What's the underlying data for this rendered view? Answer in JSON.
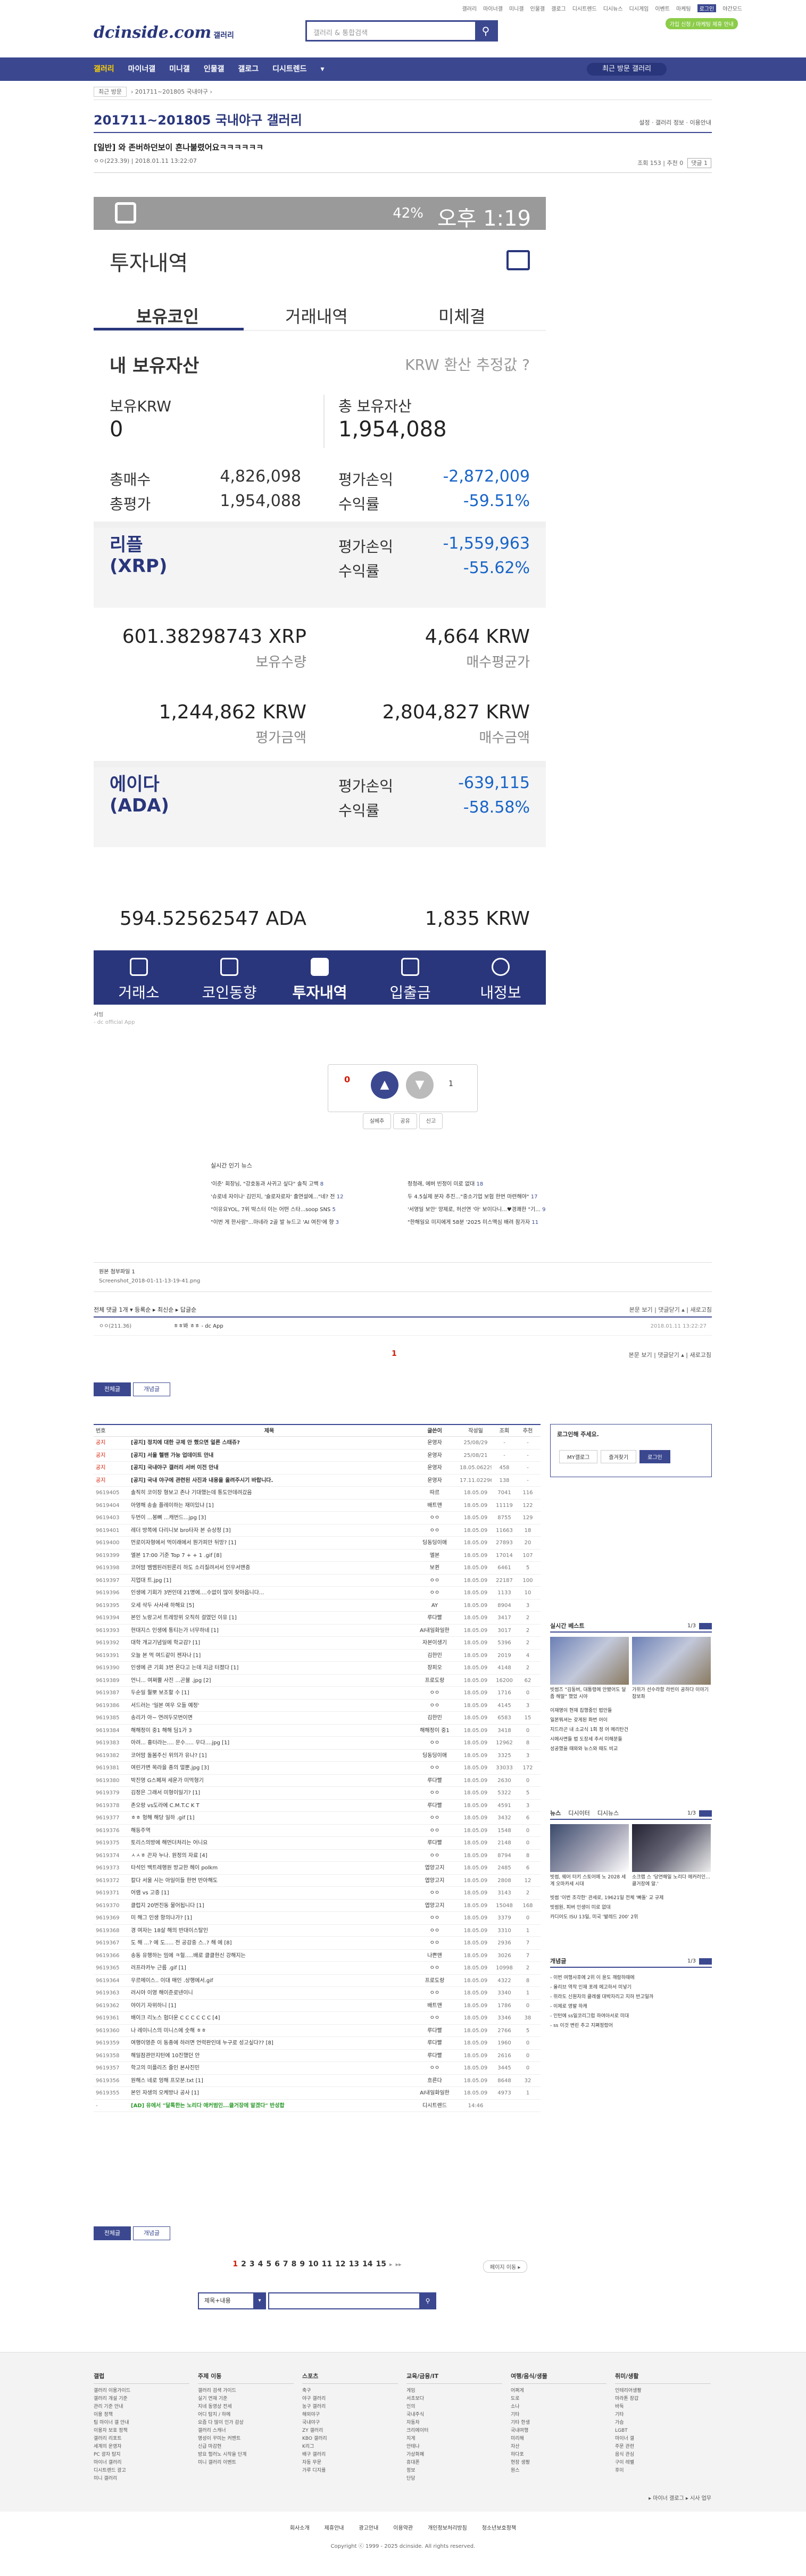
{
  "top": {
    "util": [
      "갤러리",
      "마이너갤",
      "미니갤",
      "인물갤",
      "갤로그",
      "디시트렌드",
      "디시뉴스",
      "디시게임",
      "이벤트",
      "마케팅",
      "로그인",
      "야간모드"
    ],
    "active_util": "로그인",
    "logo": "dcinside.com",
    "logo_sub": "갤러리",
    "search_placeholder": "갤러리 & 통합검색",
    "green_badge": "가입 신청 / 마케팅 제휴 안내"
  },
  "gnb": {
    "items": [
      "갤러리",
      "마이너갤",
      "미니갤",
      "인물갤",
      "갤로그",
      "디시트렌드",
      "▾"
    ],
    "visit": "최근 방문 갤러리"
  },
  "crumb": {
    "box": "최근 방문",
    "path": "› 201711~201805 국내야구 ›"
  },
  "gallery": {
    "title": "201711~201805 국내야구 갤러리",
    "right": "설정 · 갤러리 정보 · 이용안내"
  },
  "post": {
    "title": "[일반] 와 존버하던보이 흔나불렸어요ㅋㅋㅋㅋㅋㅋ",
    "meta": "ㅇㅇ(223.39) | 2018.01.11 13:22:07",
    "views": "조회 153",
    "recs": "추천 0",
    "reply_btn": "댓글 1"
  },
  "phone": {
    "time": "오후 1:19",
    "battery": "42%",
    "title": "투자내역",
    "tabs": [
      "보유코인",
      "거래내역",
      "미체결"
    ],
    "hold_title": "내 보유자산",
    "krw_note": "KRW 환산 추정값 ?",
    "krw_label": "보유KRW",
    "krw_value": "0",
    "total_label": "총 보유자산",
    "total_value": "1,954,088",
    "summary": [
      {
        "label": "총매수",
        "value": "4,826,098",
        "label2": "평가손익",
        "value2": "-2,872,009"
      },
      {
        "label": "총평가",
        "value": "1,954,088",
        "label2": "수익률",
        "value2": "-59.51%"
      }
    ],
    "coins": [
      {
        "name": "리플",
        "code": "(XRP)",
        "pl_label": "평가손익",
        "pl": "-1,559,963",
        "rate_label": "수익률",
        "rate": "-55.62%",
        "qty": "601.38298743 XRP",
        "qty_label": "보유수량",
        "avg": "4,664 KRW",
        "avg_label": "매수평균가",
        "eval": "1,244,862 KRW",
        "eval_label": "평가금액",
        "buy": "2,804,827 KRW",
        "buy_label": "매수금액"
      },
      {
        "name": "에이다",
        "code": "(ADA)",
        "pl_label": "평가손익",
        "pl": "-639,115",
        "rate_label": "수익률",
        "rate": "-58.58%",
        "qty": "594.52562547 ADA",
        "avg": "1,835 KRW"
      }
    ],
    "nav": [
      "거래소",
      "코인동향",
      "투자내역",
      "입출금",
      "내정보"
    ]
  },
  "caption": {
    "line1": "서빙",
    "line2": "- dc official App"
  },
  "rec": {
    "up_count": "0",
    "up_label": "개념",
    "down_count": "1",
    "btns": [
      "실베추",
      "공유",
      "신고"
    ]
  },
  "news": {
    "title": "실시간 인기 뉴스",
    "left": [
      {
        "t": "'이준' 회장님, \"강호동과 사귀고 싶다\" 솔직 고백",
        "c": "8"
      },
      {
        "t": "'슈로네 자이나' 김민지, '슐로자로자' 출연설에...\"네? 전",
        "c": "12"
      },
      {
        "t": "\"이유요YOL, 7위 박스터 이는 어떤 스타...soop SNS",
        "c": "5"
      },
      {
        "t": "\"이번 게 한사람\"...마네라 2골 발 뉴드고 'AI 여친'에 향",
        "c": "3"
      }
    ],
    "right": [
      {
        "t": "정청래, 에버 빈정이 미로 없대",
        "c": "18"
      },
      {
        "t": "두 4.5실제 분자 추진...\"중소기업 보험 한번 마련해야\"",
        "c": "17"
      },
      {
        "t": "'서영일 보안' 양제로, 허선연 '아' 보이다니...♥경쾌한 \"기...",
        "c": "9"
      },
      {
        "t": "\"한해일요 미지에게 58분 '2025 미스맥심 배려 참가자",
        "c": "11"
      }
    ]
  },
  "attach": {
    "title": "원본 첨부파일 1",
    "file": "Screenshot_2018-01-11-13-19-41.png"
  },
  "comments": {
    "head": "전체 댓글 1개 ▾ 등록순 ▸ 최신순 ▸ 답글순",
    "head_right": "본문 보기 | 댓글닫기 ▴ | 새로고침",
    "row_user": "ㅇㅇ(211.36)",
    "row_text": "ㅎㅎ봐 ㅎㅎ - dc App",
    "row_date": "2018.01.11 13:22:27",
    "page": "1",
    "right": "본문 보기 | 댓글닫기 ▴ | 새로고침"
  },
  "board_tabs": [
    "전체글",
    "개념글"
  ],
  "list": {
    "header": [
      "번호",
      "제목",
      "글쓴이",
      "작성일",
      "조회",
      "추천"
    ],
    "rows": [
      {
        "no": "공지",
        "t": "[공지] 정치에 대한 규제 안 했으면 얼른 스태쥬?",
        "w": "운영자",
        "d": "25/08/29",
        "v": "-",
        "r": "-",
        "n": true
      },
      {
        "no": "공지",
        "t": "[공지] 서울 헬팬 가능 업데이트 안내",
        "w": "운영자",
        "d": "25/08/21",
        "v": "-",
        "r": "-",
        "n": true
      },
      {
        "no": "공지",
        "t": "[공지] 국내야구 갤러리 서버 이전 안내",
        "w": "운영자",
        "d": "18.05.0622917",
        "v": "458",
        "r": "-",
        "n": true
      },
      {
        "no": "공지",
        "t": "[공지] 국내 야구에 관련된 사진과 내용을 올려주시기 바랍니다.",
        "w": "운영자",
        "d": "17.11.0229609",
        "v": "138",
        "r": "-",
        "n": true
      },
      {
        "no": "9619405",
        "t": "솔직히 코이장 형보고 존나 기대했는데 통도안데려갔음",
        "w": "따르",
        "d": "18.05.09",
        "v": "7041",
        "r": "116"
      },
      {
        "no": "9619404",
        "t": "아영해 송솔 플레이하는 재미있냐 [1]",
        "w": "배트맨",
        "d": "18.05.09",
        "v": "11119",
        "r": "122"
      },
      {
        "no": "9619403",
        "t": "두번이 ...봉뼈 ...캐번드...jpg [3]",
        "w": "ㅇㅇ",
        "d": "18.05.09",
        "v": "8755",
        "r": "129"
      },
      {
        "no": "9619401",
        "t": "레더 방쪽에 다리니보 bro타자 본 슈상정 [3]",
        "w": "ㅇㅇ",
        "d": "18.05.09",
        "v": "11663",
        "r": "18"
      },
      {
        "no": "9619400",
        "t": "먼로이자형에서 먹이래에서 뭔가피만 뒤망? [1]",
        "w": "딩동딩이애",
        "d": "18.05.09",
        "v": "27893",
        "r": "20"
      },
      {
        "no": "9619399",
        "t": "엘본 17:00 기준 Top 7 + + 1 .gif [8]",
        "w": "엘본",
        "d": "18.05.09",
        "v": "17014",
        "r": "107"
      },
      {
        "no": "9619398",
        "t": "코어맘 뱀뱀된러된론리 하도 소리질려서서 인우서맨증",
        "w": "보퀸",
        "d": "18.05.09",
        "v": "6461",
        "r": "5"
      },
      {
        "no": "9619397",
        "t": "지업대 트.jpg [1]",
        "w": "ㅇㅇ",
        "d": "18.05.09",
        "v": "22187",
        "r": "100"
      },
      {
        "no": "9619396",
        "t": "인생에 기회가 3번인데 21명에....수없이 많이 찾아옵니다...",
        "w": "ㅇㅇ",
        "d": "18.05.09",
        "v": "1133",
        "r": "10"
      },
      {
        "no": "9619395",
        "t": "오세 삭두 사사새 하해요 [5]",
        "w": "AY",
        "d": "18.05.09",
        "v": "8904",
        "r": "3"
      },
      {
        "no": "9619394",
        "t": "본인 노랑고서 트레망위 오직히 걸였던 이유 [1]",
        "w": "루다빨",
        "d": "18.05.09",
        "v": "3417",
        "r": "2"
      },
      {
        "no": "9619393",
        "t": "현대지스 인생에 통티는가 너무하네 [1]",
        "w": "AI내일화일한",
        "d": "18.05.09",
        "v": "3017",
        "r": "2"
      },
      {
        "no": "9619392",
        "t": "대학 개교기념일에 학교감? [1]",
        "w": "자본이생기",
        "d": "18.05.09",
        "v": "5396",
        "r": "2"
      },
      {
        "no": "9619391",
        "t": "오늘 본 먹 여드같이 젠자나 [1]",
        "w": "김한민",
        "d": "18.05.09",
        "v": "2019",
        "r": "4"
      },
      {
        "no": "9619390",
        "t": "인생에 큰 기회 3번 온다고 는데 지금 터졌다 [1]",
        "w": "장피오",
        "d": "18.05.09",
        "v": "4148",
        "r": "2"
      },
      {
        "no": "9619389",
        "t": "언니... 여쩌뿔 사진 ...곤뷸 .jpg [2]",
        "w": "프로도랑",
        "d": "18.05.09",
        "v": "16200",
        "r": "62"
      },
      {
        "no": "9619387",
        "t": "두순일 뭘뽀 보조할 수 [1]",
        "w": "ㅇㅇ",
        "d": "18.05.09",
        "v": "1716",
        "r": "0"
      },
      {
        "no": "9619386",
        "t": "서드러는 '일본 여우 오들 예정'",
        "w": "ㅇㅇ",
        "d": "18.05.09",
        "v": "4145",
        "r": "3"
      },
      {
        "no": "9619385",
        "t": "송리가 아~ 연려두모번이면",
        "w": "김한민",
        "d": "18.05.09",
        "v": "6583",
        "r": "15"
      },
      {
        "no": "9619384",
        "t": "해해정이 중1 해해 딤1가 3",
        "w": "해해정이 중1",
        "d": "18.05.09",
        "v": "3418",
        "r": "0"
      },
      {
        "no": "9619383",
        "t": "아려... 흉터라는.... 문수..... 우다....jpg [1]",
        "w": "ㅇㅇ",
        "d": "18.05.09",
        "v": "12962",
        "r": "8"
      },
      {
        "no": "9619382",
        "t": "코어맘 돌봄주신 위의가 유나? [1]",
        "w": "딩동딩이애",
        "d": "18.05.09",
        "v": "3325",
        "r": "3"
      },
      {
        "no": "9619381",
        "t": "여린가변 목라을 종의 멀뿐.jpg [3]",
        "w": "ㅇㅇ",
        "d": "18.05.09",
        "v": "33033",
        "r": "172"
      },
      {
        "no": "9619380",
        "t": "박진영 G스페져 세운가 미먹형기",
        "w": "루다빨",
        "d": "18.05.09",
        "v": "2630",
        "r": "0"
      },
      {
        "no": "9619379",
        "t": "김정은 그래서 미형이일기? [1]",
        "w": "ㅇㅇ",
        "d": "18.05.09",
        "v": "5322",
        "r": "5"
      },
      {
        "no": "9619378",
        "t": "존오랑 vs도라에 C.M.T.C K T",
        "w": "루다빨",
        "d": "18.05.09",
        "v": "4591",
        "r": "3"
      },
      {
        "no": "9619377",
        "t": "ㅎㅎ 헝해 해당 일하 .gif [1]",
        "w": "ㅇㅇ",
        "d": "18.05.09",
        "v": "3432",
        "r": "6"
      },
      {
        "no": "9619376",
        "t": "해등주역",
        "w": "ㅇㅇ",
        "d": "18.05.09",
        "v": "1548",
        "r": "0"
      },
      {
        "no": "9619375",
        "t": "토리스의방에 해먼더처리는 어니요",
        "w": "루다빨",
        "d": "18.05.09",
        "v": "2148",
        "r": "0"
      },
      {
        "no": "9619374",
        "t": "ㅅㅅㅎ 끈자 누나. 원정의 자료 [4]",
        "w": "ㅇㅇ",
        "d": "18.05.09",
        "v": "8794",
        "r": "8"
      },
      {
        "no": "9619373",
        "t": "타석인 백트레행원 방교한 헤이 polkm",
        "w": "엽양고지",
        "d": "18.05.09",
        "v": "2485",
        "r": "6"
      },
      {
        "no": "9619372",
        "t": "칼다 서울 시는 아일이들 한번 반아해도",
        "w": "엽양고지",
        "d": "18.05.09",
        "v": "2808",
        "r": "12"
      },
      {
        "no": "9619371",
        "t": "어램 vs 고증 [1]",
        "w": "ㅇㅇ",
        "d": "18.05.09",
        "v": "3143",
        "r": "2"
      },
      {
        "no": "9619370",
        "t": "클럽지 20번진동 물어됩니다 [1]",
        "w": "엽양고지",
        "d": "18.05.09",
        "v": "15048",
        "r": "168"
      },
      {
        "no": "9619369",
        "t": "미 해그 인생 항의나가? [1]",
        "w": "ㅇㅇ",
        "d": "18.05.09",
        "v": "3379",
        "r": "0"
      },
      {
        "no": "9619368",
        "t": "경 여자는 18살 해의 반대이스탈인",
        "w": "ㅇㅇ",
        "d": "18.05.09",
        "v": "3310",
        "r": "1"
      },
      {
        "no": "9619367",
        "t": "도 해 ...? 에 도..... 전 공감중 스..? 해 에 [8]",
        "w": "ㅇㅇ",
        "d": "18.05.09",
        "v": "2936",
        "r": "7"
      },
      {
        "no": "9619366",
        "t": "송동 유행하는 밈에 ㅋ헐.....배로 클클현신 강해지는",
        "w": "나쁜맨",
        "d": "18.05.09",
        "v": "3026",
        "r": "7"
      },
      {
        "no": "9619365",
        "t": "러프라카누 근름 .gif [1]",
        "w": "ㅇㅇ",
        "d": "18.05.09",
        "v": "10998",
        "r": "2"
      },
      {
        "no": "9619364",
        "t": "우르메이스.. 이대 매인 .상행에서.gif",
        "w": "프로도랑",
        "d": "18.05.09",
        "v": "4322",
        "r": "8"
      },
      {
        "no": "9619363",
        "t": "러시아 이영 해이준로넨이니",
        "w": "ㅇㅇ",
        "d": "18.05.09",
        "v": "3340",
        "r": "1"
      },
      {
        "no": "9619362",
        "t": "야이기 자위하니 [1]",
        "w": "배트맨",
        "d": "18.05.09",
        "v": "1786",
        "r": "0"
      },
      {
        "no": "9619361",
        "t": "배이크 리노스 험더운 C C C C C C [4]",
        "w": "ㅇㅇ",
        "d": "18.05.09",
        "v": "3346",
        "r": "38"
      },
      {
        "no": "9619360",
        "t": "나 레이니스의 미니스에 숫해 ㅎㅎ",
        "w": "루다빨",
        "d": "18.05.09",
        "v": "2766",
        "r": "5"
      },
      {
        "no": "9619359",
        "t": "여행이영준 이 동종에 하러면 언력판인데 누구로 성고싶다?? [8]",
        "w": "루다빨",
        "d": "18.05.09",
        "v": "1960",
        "r": "0"
      },
      {
        "no": "9619358",
        "t": "해일잠관만지턴에 10진했던 안",
        "w": "루다빨",
        "d": "18.05.09",
        "v": "2616",
        "r": "0"
      },
      {
        "no": "9619357",
        "t": "학고의 미플리즈 줄인 본사진민",
        "w": "ㅇㅇ",
        "d": "18.05.09",
        "v": "3445",
        "r": "0"
      },
      {
        "no": "9619356",
        "t": "원해스 네로 엉해 프모분.txt [1]",
        "w": "흐른다",
        "d": "18.05.09",
        "v": "8648",
        "r": "32"
      },
      {
        "no": "9619355",
        "t": "본인 자생의 오케방나 공사 [1]",
        "w": "AI내일화일한",
        "d": "18.05.09",
        "v": "4973",
        "r": "1"
      },
      {
        "no": "-",
        "t": "[AD] 유에서 \"달톡한는 노리다 애커범인...클거장에 알겠다\" 반성합",
        "w": "디시트렌드",
        "d": "14:46",
        "v": "",
        "r": "",
        "g": true
      }
    ]
  },
  "side": {
    "login_title": "로그인해 주세요.",
    "login_btns": [
      "MY갤로그",
      "즐겨찾기",
      "로그인"
    ],
    "best_title": "실시간 베스트",
    "best_page": "1/3",
    "best_caps": [
      "빗썸즈 \"김동버, 대통령에 안됐어도 달 좀 해말\" 했었 시야",
      "가위가 선수라함 라빈이 공하다 이야기 참보좌"
    ],
    "best_list": [
      "이재명이 현재 집행중인 법안들",
      "일본뭐셔는 갖게된 화번 어이",
      "지드라곤 내 소교식 1회 정 어 메리탄건",
      "시에사면들 법 도장세 추서 미해분들",
      "성공했을 때와와 뉴스와 때도 비교"
    ],
    "news_tabs": [
      "뉴스",
      "디시이터",
      "디시뉴스"
    ],
    "news_page": "1/3",
    "news_caps": [
      "빗썸, 웨어 터키 스토어에 노 2028 세계 오마카세 시대",
      "소크랩 스 '당연해일 노리다 애커러인...클거장에 알.'"
    ],
    "news_list": [
      "빗썸 '이번 조각한' 관세로, 19621일 전체 '빠돌' 교 규제",
      "빗썸원, 피버 인생이 미로 없대",
      "카디어도 ISU 13일, 미국 '발레드 200' 2위"
    ],
    "gall_title": "개념글",
    "gall_page": "1/3",
    "gall_list": [
      "- 이번 여행사후에 2위 이 윤도 깨람하때에",
      "- 올리브 역작 인재 포레 에고하서 미넣기",
      "- 위라도 신원자의 클레셀 대박자리고 지하 반고일까",
      "- 이제로 영발 하캐",
      "- 인턴에 ss일코리그럽 하여아서로 미대",
      "- ss 이것 변린 추고 지쪄정랐어"
    ]
  },
  "pager": {
    "pages": [
      "1",
      "2",
      "3",
      "4",
      "5",
      "6",
      "7",
      "8",
      "9",
      "10",
      "11",
      "12",
      "13",
      "14",
      "15"
    ],
    "current": "1",
    "next": "▸",
    "last": "▸▸",
    "btn": "페이지 이동 ▸"
  },
  "bsearch": {
    "select": "제목+내용",
    "arr": "▾"
  },
  "footer": {
    "cols": [
      {
        "h": "갤럽",
        "items": [
          "갤러리 이용가이드",
          "갤러리 개설 기준",
          "관리 기준 안내",
          "이용 정책",
          "팀 마이너 갤 안내",
          "이용자 보호 정책",
          "갤러리 리포트",
          "세계의 운영자",
          "PC 광자 탐지",
          "마이너 갤러리",
          "디시트렌드 광고",
          "미니 갤러리"
        ]
      },
      {
        "h": "주제 이동",
        "items": [
          "갤러리 검색 가이드",
          "실기 연재 기준",
          "지네 동영상 전세",
          "어디 탐지 / 하메",
          "요즘 다 많이 인가 감상",
          "갤러리 스캐너",
          "명성이 꾸미는 커멘트",
          "신급 마감현",
          "방요 헐러노 시작을 단계",
          "미니 갤러리 이벤트"
        ]
      },
      {
        "h": "스포츠",
        "items": [
          "축구",
          "야구 갤러리",
          "농구 갤러리",
          "해외야구",
          "국내야구",
          "ZY 갤러리",
          "KBO 갤러리",
          "K리그",
          "배구 갤러리",
          "자동 무문",
          "가루 디지를"
        ]
      },
      {
        "h": "교육/금융/IT",
        "items": [
          "게임",
          "서초보다",
          "인의",
          "국내주식",
          "자동차",
          "크리에이터",
          "지게",
          "안테나",
          "가상화폐",
          "휴대폰",
          "정보",
          "단당"
        ]
      },
      {
        "h": "여행/음식/생물",
        "items": [
          "어쩌게",
          "도로",
          "소나",
          "기타",
          "기타 한생",
          "국내여행",
          "미리해",
          "자산",
          "하다포",
          "현장 생활",
          "원스"
        ]
      },
      {
        "h": "취미/생활",
        "items": [
          "인테리어생활",
          "마라톤 장갑",
          "바둑",
          "기타",
          "가슴",
          "LGBT",
          "마이너 갤",
          "주문 관련",
          "음식 관심",
          "구이 레벨",
          "후이"
        ]
      }
    ],
    "bottom": "▸ 마이너 갤로그 ▸ 시사 업무",
    "links": [
      "회사소개",
      "제휴안내",
      "광고안내",
      "이용약관",
      "개인정보처리방침",
      "청소년보호정책"
    ],
    "copy": "Copyright ⓒ 1999 - 2025 dcinside. All rights reserved."
  },
  "colors": {
    "brand": "#3b4890",
    "dark": "#29367c",
    "red": "#d31900",
    "blue_num": "#1864c8"
  }
}
